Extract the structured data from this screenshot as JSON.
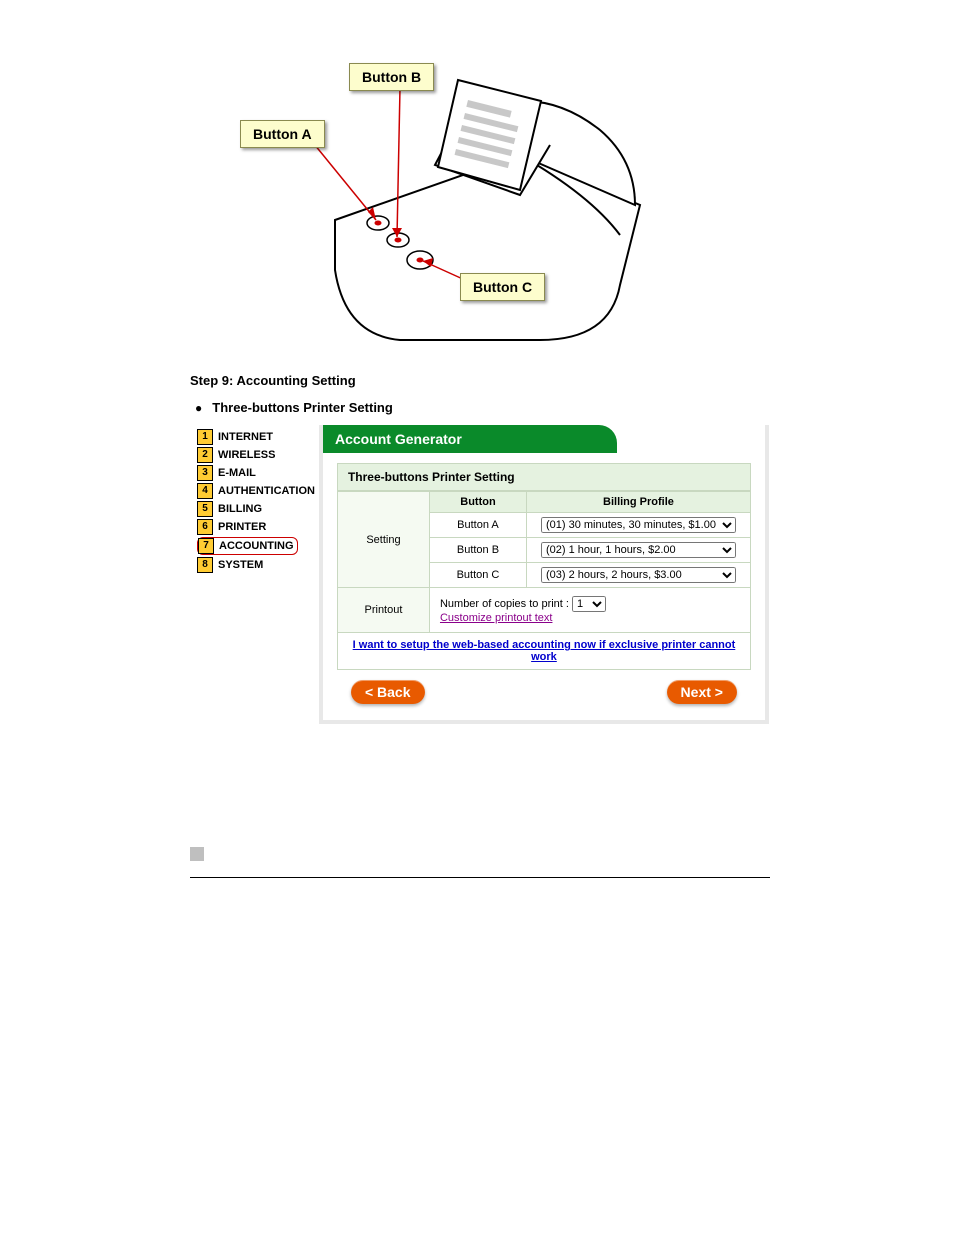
{
  "callouts": {
    "a": "Button A",
    "b": "Button B",
    "c": "Button C"
  },
  "step_heading": "Step 9: Accounting Setting",
  "bullet": "Three-buttons Printer Setting",
  "sidebar": {
    "items": [
      {
        "n": "1",
        "label": "INTERNET"
      },
      {
        "n": "2",
        "label": "WIRELESS"
      },
      {
        "n": "3",
        "label": "E-MAIL"
      },
      {
        "n": "4",
        "label": "AUTHENTICATION"
      },
      {
        "n": "5",
        "label": "BILLING"
      },
      {
        "n": "6",
        "label": "PRINTER"
      },
      {
        "n": "7",
        "label": "ACCOUNTING"
      },
      {
        "n": "8",
        "label": "SYSTEM"
      }
    ]
  },
  "panel": {
    "tab": "Account Generator",
    "section_title": "Three-buttons Printer Setting",
    "headers": {
      "button": "Button",
      "profile": "Billing Profile"
    },
    "setting_label": "Setting",
    "rows": [
      {
        "button": "Button A",
        "profile": "(01) 30 minutes, 30 minutes, $1.00"
      },
      {
        "button": "Button B",
        "profile": "(02) 1 hour, 1 hours, $2.00"
      },
      {
        "button": "Button C",
        "profile": "(03) 2 hours, 2 hours, $3.00"
      }
    ],
    "printout_label": "Printout",
    "copies_label": "Number of copies to print :",
    "copies_value": "1",
    "customize_link": "Customize printout text",
    "web_link": "I want to setup the web-based accounting now if exclusive printer cannot work",
    "back": "< Back",
    "next": "Next >"
  }
}
